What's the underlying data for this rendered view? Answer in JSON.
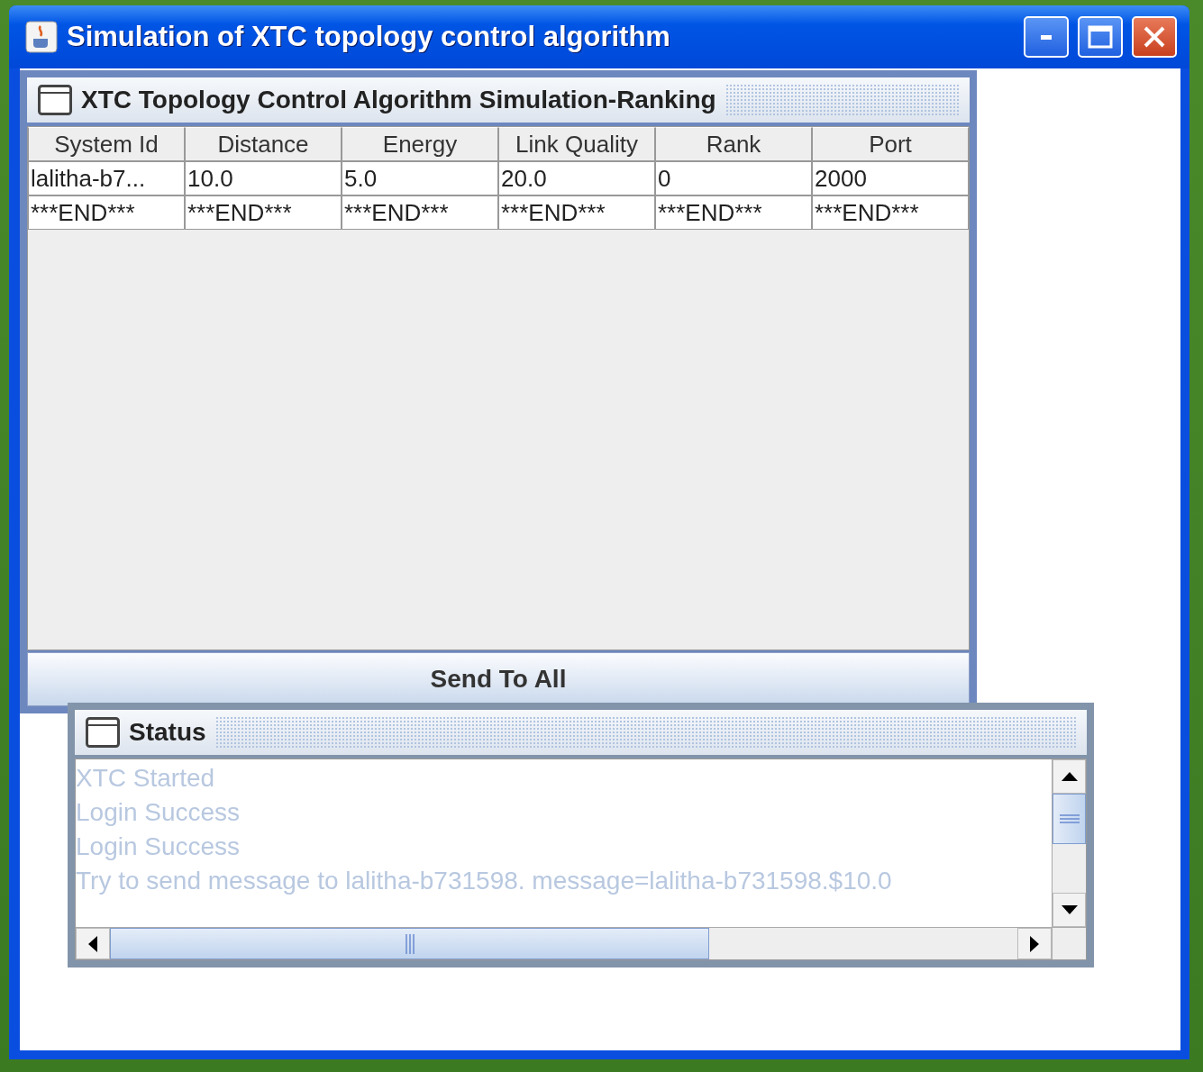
{
  "window": {
    "title": "Simulation of XTC topology control algorithm"
  },
  "ranking_frame": {
    "title": "XTC Topology Control Algorithm Simulation-Ranking",
    "table": {
      "columns": [
        "System Id",
        "Distance",
        "Energy",
        "Link Quality",
        "Rank",
        "Port"
      ],
      "rows": [
        [
          "lalitha-b7...",
          "10.0",
          "5.0",
          "20.0",
          "0",
          "2000"
        ],
        [
          "***END***",
          "***END***",
          "***END***",
          "***END***",
          "***END***",
          "***END***"
        ]
      ]
    },
    "button": "Send To All"
  },
  "status_frame": {
    "title": "Status",
    "lines": [
      "XTC Started",
      "Login Success",
      "Login Success",
      "Try to send message to lalitha-b731598. message=lalitha-b731598.$10.0"
    ]
  }
}
